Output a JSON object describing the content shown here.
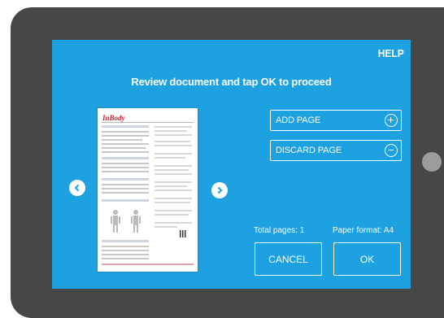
{
  "screen": {
    "help_label": "HELP",
    "title": "Review document and tap OK to proceed"
  },
  "preview": {
    "logo_text": "InBody",
    "prev_icon": "chevron-left-icon",
    "next_icon": "chevron-right-icon"
  },
  "actions": {
    "add_page_label": "ADD PAGE",
    "add_icon": "plus-circle-icon",
    "discard_page_label": "DISCARD PAGE",
    "discard_icon": "minus-circle-icon"
  },
  "info": {
    "total_pages": "Total pages: 1",
    "paper_format": "Paper format: A4"
  },
  "footer": {
    "cancel_label": "CANCEL",
    "ok_label": "OK"
  },
  "colors": {
    "screen_bg": "#1da1e1",
    "bezel": "#474747",
    "home_button": "#9c9c9c",
    "logo_red": "#c8202f"
  }
}
